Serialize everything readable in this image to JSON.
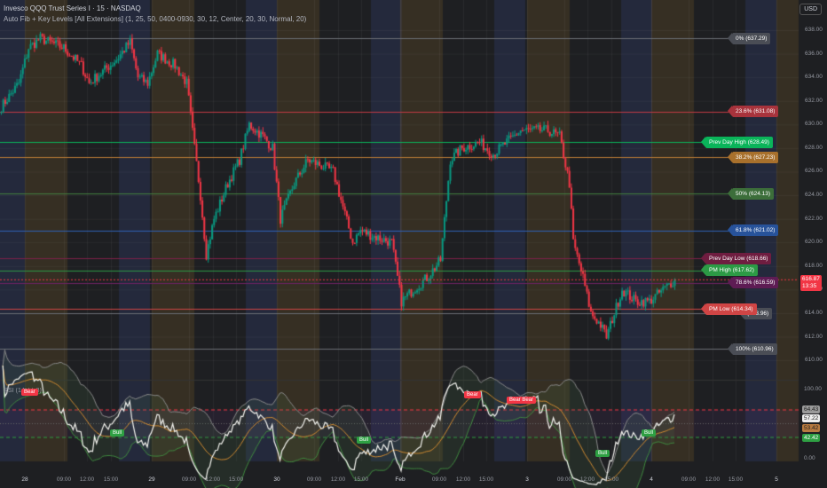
{
  "header": {
    "symbol": "Invesco QQQ Trust Series I · 15 · NASDAQ",
    "indicator": "Auto Fib + Key Levels [All Extensions] (1, 25, 50, 0400-0930, 30, 12, Center, 20, 30, Normal, 20)",
    "currency": "USD"
  },
  "chart_data": {
    "type": "candlestick",
    "title": "Invesco QQQ Trust Series I · 15 · NASDAQ",
    "interval_minutes": 15,
    "ylim": [
      610,
      638
    ],
    "yticks": [
      610,
      612,
      614,
      616,
      618,
      620,
      622,
      624,
      626,
      628,
      630,
      632,
      634,
      636,
      638
    ],
    "ytick_labels": [
      "610.00",
      "612.00",
      "614.00",
      "616.00",
      "618.00",
      "620.00",
      "622.00",
      "624.00",
      "626.00",
      "628.00",
      "630.00",
      "632.00",
      "634.00",
      "636.00",
      "638.00"
    ],
    "close_path_bar_price": [
      [
        0,
        631.5
      ],
      [
        9,
        633.5
      ],
      [
        14,
        636.5
      ],
      [
        20,
        637.3
      ],
      [
        32,
        636.5
      ],
      [
        41,
        635
      ],
      [
        45,
        633.5
      ],
      [
        52,
        634.5
      ],
      [
        59,
        635.5
      ],
      [
        66,
        637
      ],
      [
        70,
        634
      ],
      [
        75,
        633.5
      ],
      [
        80,
        636
      ],
      [
        89,
        635
      ],
      [
        95,
        633.5
      ],
      [
        99,
        628
      ],
      [
        102,
        624
      ],
      [
        105,
        619
      ],
      [
        109,
        622
      ],
      [
        116,
        625
      ],
      [
        122,
        627
      ],
      [
        127,
        630
      ],
      [
        134,
        629
      ],
      [
        139,
        628
      ],
      [
        143,
        622
      ],
      [
        150,
        625
      ],
      [
        157,
        627
      ],
      [
        164,
        626.5
      ],
      [
        170,
        626
      ],
      [
        175,
        623
      ],
      [
        180,
        620
      ],
      [
        184,
        621
      ],
      [
        191,
        620.5
      ],
      [
        200,
        620
      ],
      [
        205,
        615
      ],
      [
        211,
        616
      ],
      [
        218,
        617
      ],
      [
        225,
        618.5
      ],
      [
        230,
        627
      ],
      [
        236,
        628
      ],
      [
        245,
        628.5
      ],
      [
        252,
        627.5
      ],
      [
        259,
        628.5
      ],
      [
        266,
        629.5
      ],
      [
        273,
        629.5
      ],
      [
        280,
        629.5
      ],
      [
        286,
        629
      ],
      [
        291,
        625
      ],
      [
        293,
        620
      ],
      [
        298,
        617
      ],
      [
        302,
        614
      ],
      [
        307,
        613
      ],
      [
        310,
        612
      ],
      [
        314,
        614
      ],
      [
        318,
        616
      ],
      [
        325,
        615
      ],
      [
        332,
        615
      ],
      [
        339,
        616
      ],
      [
        345,
        616.87
      ]
    ],
    "current_price": {
      "value": "616.87",
      "countdown": "13:35"
    },
    "levels": [
      {
        "label": "0% (637.29)",
        "price": 637.29,
        "color": "#4a4d55",
        "line": "#6b6e75",
        "style": "fib"
      },
      {
        "label": "23.6% (631.08)",
        "price": 631.08,
        "color": "#a8333c",
        "line": "#c23a44",
        "style": "fib"
      },
      {
        "label": "Prev Day High (628.49)",
        "price": 628.49,
        "color": "#0ab45a",
        "line": "#0ab45a",
        "style": "key"
      },
      {
        "label": "38.2% (627.23)",
        "price": 627.23,
        "color": "#a8702c",
        "line": "#b87a35",
        "style": "fib"
      },
      {
        "label": "50% (624.13)",
        "price": 624.13,
        "color": "#3c6e3a",
        "line": "#43803f",
        "style": "fib"
      },
      {
        "label": "61.8% (621.02)",
        "price": 621.02,
        "color": "#27529a",
        "line": "#2f62b8",
        "style": "fib"
      },
      {
        "label": "Prev Day Low (618.66)",
        "price": 618.66,
        "color": "#6f1d40",
        "line": "#7d2048",
        "style": "key"
      },
      {
        "label": "PM High (617.62)",
        "price": 617.62,
        "color": "#2c9a45",
        "line": "#2c9a45",
        "style": "key"
      },
      {
        "label": "78.6% (616.59)",
        "price": 616.59,
        "color": "#5e1c54",
        "line": "#6d2263",
        "style": "fib"
      },
      {
        "label": "(613.96)",
        "price": 613.96,
        "color": "#4a4d55",
        "line": "#6b6e75",
        "style": "fib"
      },
      {
        "label": "PM Low (614.34)",
        "price": 614.34,
        "color": "#d04545",
        "line": "#d04545",
        "style": "key"
      },
      {
        "label": "100% (610.96)",
        "price": 610.96,
        "color": "#4a4d55",
        "line": "#6b6e75",
        "style": "fib"
      }
    ],
    "xtick_labels": [
      "28",
      "09:00",
      "12:00",
      "15:00",
      "29",
      "09:00",
      "12:00",
      "15:00",
      "30",
      "09:00",
      "12:00",
      "15:00",
      "Feb",
      "09:00",
      "12:00",
      "15:00",
      "3",
      "09:00",
      "12:00",
      "15:00",
      "4",
      "09:00",
      "12:00",
      "15:00",
      "5"
    ],
    "rsi": {
      "title": "RSI (14, hlc3)",
      "period": 14,
      "overbought": 64.43,
      "oversold": 42.42,
      "yticks": [
        "100.00",
        "0.00"
      ],
      "values": {
        "rsi": "57.22",
        "ma": "53.42",
        "upper": "64.43",
        "lower": "42.42"
      },
      "signals": [
        "Bear",
        "Bull",
        "Bull",
        "Bear",
        "Bear Bear",
        "Bull",
        "Bull"
      ]
    }
  }
}
